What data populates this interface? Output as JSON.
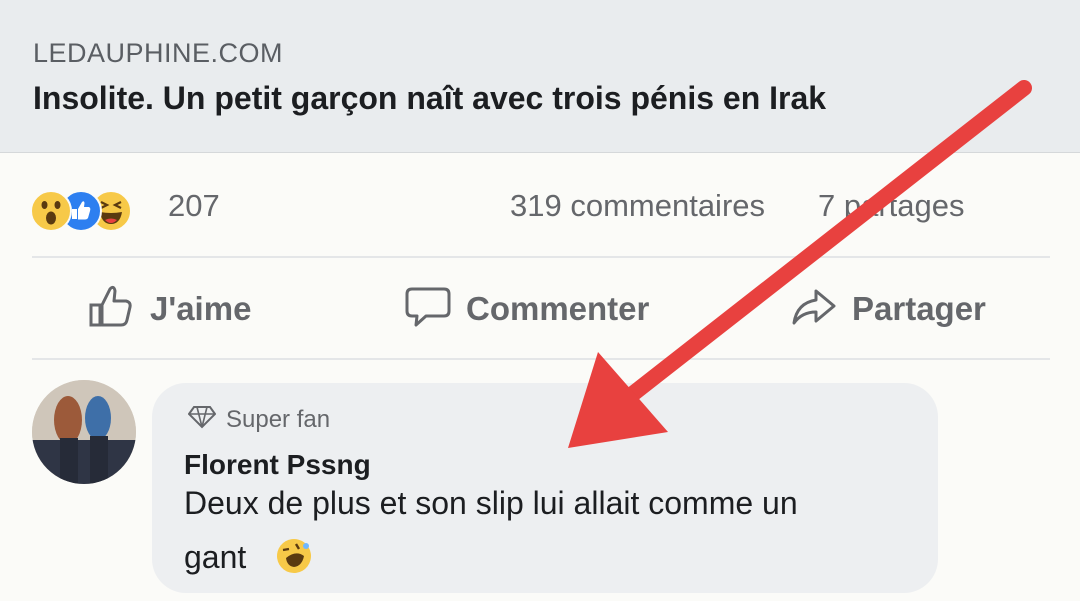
{
  "link": {
    "domain": "LEDAUPHINE.COM",
    "title": "Insolite. Un petit garçon naît avec trois pénis en Irak"
  },
  "stats": {
    "reaction_count": "207",
    "comments": "319 commentaires",
    "shares": "7  partages"
  },
  "actions": {
    "like": "J'aime",
    "comment": "Commenter",
    "share": "Partager"
  },
  "comment": {
    "badge": "Super fan",
    "author": "Florent Pssng",
    "line1": "Deux de plus et son slip lui allait comme un",
    "line2": "gant"
  },
  "colors": {
    "annotation_arrow": "#e8413f",
    "like_blue": "#2d7ff0",
    "reaction_yellow": "#f7c948"
  },
  "icons": [
    "wow-reaction-icon",
    "like-reaction-icon",
    "haha-reaction-icon",
    "thumbs-up-icon",
    "comment-icon",
    "share-icon",
    "diamond-icon",
    "rofl-emoji-icon"
  ]
}
